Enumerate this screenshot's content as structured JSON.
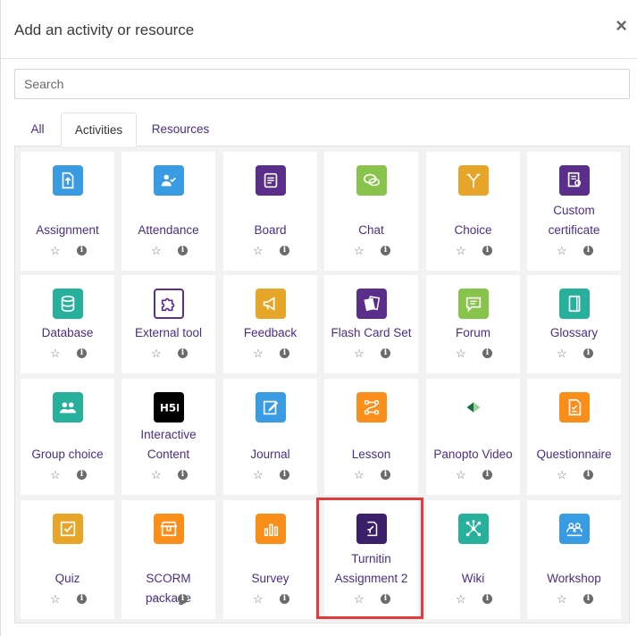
{
  "dialog": {
    "title": "Add an activity or resource",
    "close_symbol": "×"
  },
  "search": {
    "placeholder": "Search"
  },
  "tabs": [
    {
      "label": "All"
    },
    {
      "label": "Activities"
    },
    {
      "label": "Resources"
    }
  ],
  "actions": {
    "star_symbol": "☆",
    "info_symbol": "i"
  },
  "tiles": [
    {
      "label": "Assignment",
      "icon": "assignment-icon",
      "color": "#399be2"
    },
    {
      "label": "Attendance",
      "icon": "attendance-icon",
      "color": "#399be2"
    },
    {
      "label": "Board",
      "icon": "board-icon",
      "color": "#5b2e8c"
    },
    {
      "label": "Chat",
      "icon": "chat-icon",
      "color": "#88c34b"
    },
    {
      "label": "Choice",
      "icon": "choice-icon",
      "color": "#e7a529"
    },
    {
      "label": "Custom certificate",
      "icon": "certificate-icon",
      "color": "#5b2e8c"
    },
    {
      "label": "Database",
      "icon": "database-icon",
      "color": "#27b19c"
    },
    {
      "label": "External tool",
      "icon": "puzzle-icon",
      "color": "#ffffff"
    },
    {
      "label": "Feedback",
      "icon": "megaphone-icon",
      "color": "#e7a529"
    },
    {
      "label": "Flash Card Set",
      "icon": "flashcard-icon",
      "color": "#5b2e8c"
    },
    {
      "label": "Forum",
      "icon": "forum-icon",
      "color": "#88c34b"
    },
    {
      "label": "Glossary",
      "icon": "glossary-icon",
      "color": "#27b19c"
    },
    {
      "label": "Group choice",
      "icon": "group-icon",
      "color": "#27b19c"
    },
    {
      "label": "Interactive Content",
      "icon": "h5p-icon",
      "color": "#000000"
    },
    {
      "label": "Journal",
      "icon": "journal-icon",
      "color": "#399be2"
    },
    {
      "label": "Lesson",
      "icon": "lesson-icon",
      "color": "#f98e1a"
    },
    {
      "label": "Panopto Video",
      "icon": "panopto-icon",
      "color": "#ffffff"
    },
    {
      "label": "Questionnaire",
      "icon": "questionnaire-icon",
      "color": "#f98e1a"
    },
    {
      "label": "Quiz",
      "icon": "quiz-icon",
      "color": "#e7a529"
    },
    {
      "label": "SCORM package",
      "icon": "package-icon",
      "color": "#f98e1a"
    },
    {
      "label": "Survey",
      "icon": "survey-icon",
      "color": "#f98e1a"
    },
    {
      "label": "Turnitin Assignment 2",
      "icon": "turnitin-icon",
      "color": "#3b1f6b"
    },
    {
      "label": "Wiki",
      "icon": "wiki-icon",
      "color": "#27b19c"
    },
    {
      "label": "Workshop",
      "icon": "workshop-icon",
      "color": "#399be2"
    }
  ]
}
